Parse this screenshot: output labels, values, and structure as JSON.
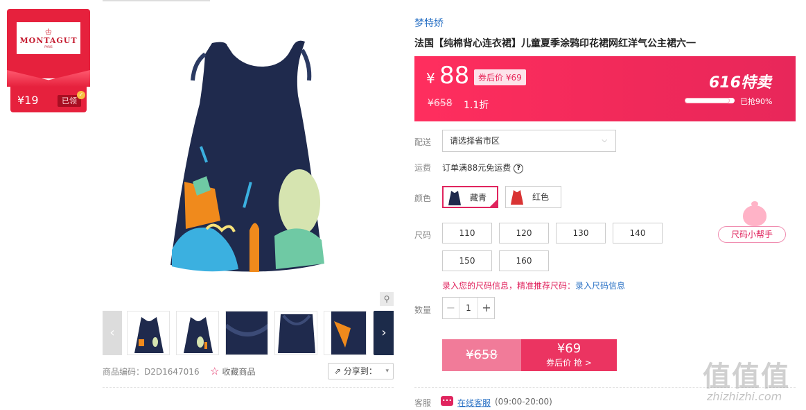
{
  "coupon_card": {
    "logo_text": "MONTAGUT",
    "logo_sub": "PARIS",
    "price": "¥19",
    "status": "已领"
  },
  "gallery": {
    "thumbnail_count": 6
  },
  "meta": {
    "sku_label": "商品编码：",
    "sku_value": "D2D1647016",
    "favorite_label": "收藏商品",
    "share_label": "分享到："
  },
  "product": {
    "brand": "梦特娇",
    "title": "法国【纯棉背心连衣裙】儿童夏季涂鸦印花裙网红洋气公主裙六一"
  },
  "price_box": {
    "currency": "¥",
    "price": "88",
    "coupon_price": "券后价 ¥69",
    "original_price": "¥658",
    "discount": "1.1折",
    "sale_event": "616特卖",
    "sold_text": "已抢90%",
    "sold_fraction": 0.9
  },
  "delivery": {
    "label": "配送",
    "region_placeholder": "请选择省市区"
  },
  "shipping": {
    "label": "运费",
    "text": "订单满88元免运费"
  },
  "color": {
    "label": "颜色",
    "options": [
      {
        "name": "藏青",
        "selected": true,
        "swatch": "#1f2a4d"
      },
      {
        "name": "红色",
        "selected": false,
        "swatch": "#d93434"
      }
    ]
  },
  "size": {
    "label": "尺码",
    "options": [
      "110",
      "120",
      "130",
      "140",
      "150",
      "160"
    ],
    "tip": "录入您的尺码信息，精准推荐尺码：",
    "tip_link": "录入尺码信息",
    "helper": "尺码小帮手"
  },
  "quantity": {
    "label": "数量",
    "minus": "−",
    "value": "1",
    "plus": "+"
  },
  "buy": {
    "original": "¥658",
    "price": "¥69",
    "action": "券后价 抢 >"
  },
  "service": {
    "label": "客服",
    "link": "在线客服",
    "hours": "(09:00-20:00)"
  },
  "watermark": {
    "chars": "值值值",
    "url": "zhizhizhi.com"
  },
  "colors": {
    "accent": "#e0245e",
    "price_bg": "#f0295a",
    "link": "#2e74c6"
  }
}
